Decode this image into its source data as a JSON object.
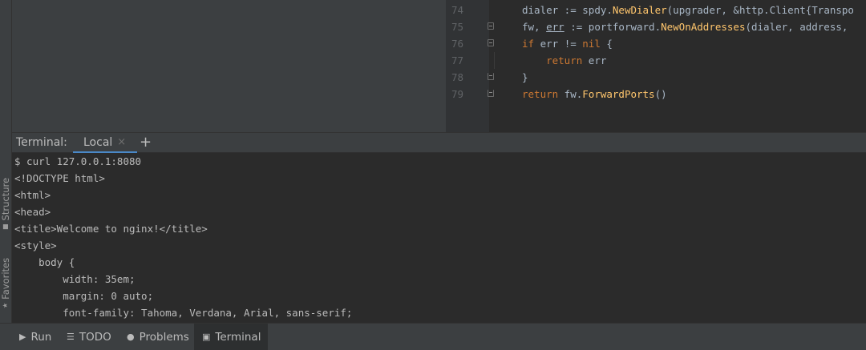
{
  "side_tabs": {
    "structure": "Structure",
    "favorites": "Favorites"
  },
  "editor": {
    "lines": [
      {
        "num": "74",
        "parts": [
          [
            "",
            "dialer := "
          ],
          [
            "pkg",
            "spdy."
          ],
          [
            "fn",
            "NewDialer"
          ],
          [
            "",
            "(upgrader, &"
          ],
          [
            "pkg",
            "http."
          ],
          [
            "ty",
            "Client"
          ],
          [
            "",
            "{Transpo"
          ]
        ]
      },
      {
        "num": "75",
        "parts": [
          [
            "",
            "fw, "
          ],
          [
            "err",
            "err"
          ],
          [
            "",
            " := "
          ],
          [
            "pkg",
            "portforward."
          ],
          [
            "fn",
            "NewOnAddresses"
          ],
          [
            "",
            "(dialer, address, "
          ]
        ]
      },
      {
        "num": "76",
        "parts": [
          [
            "kw",
            "if"
          ],
          [
            "",
            " err != "
          ],
          [
            "kw",
            "nil"
          ],
          [
            "",
            " {"
          ]
        ]
      },
      {
        "num": "77",
        "parts": [
          [
            "",
            "    "
          ],
          [
            "kw",
            "return"
          ],
          [
            "",
            " err"
          ]
        ]
      },
      {
        "num": "78",
        "parts": [
          [
            "",
            "}"
          ]
        ]
      },
      {
        "num": "79",
        "parts": [
          [
            "kw",
            "return"
          ],
          [
            "",
            " fw."
          ],
          [
            "fn",
            "ForwardPorts"
          ],
          [
            "",
            "()"
          ]
        ]
      }
    ]
  },
  "terminal": {
    "title": "Terminal:",
    "tab_label": "Local",
    "close_glyph": "×",
    "add_glyph": "+",
    "lines": [
      "$ curl 127.0.0.1:8080",
      "<!DOCTYPE html>",
      "<html>",
      "<head>",
      "<title>Welcome to nginx!</title>",
      "<style>",
      "    body {",
      "        width: 35em;",
      "        margin: 0 auto;",
      "        font-family: Tahoma, Verdana, Arial, sans-serif;"
    ]
  },
  "bottom_bar": {
    "run": "Run",
    "todo": "TODO",
    "problems": "Problems",
    "terminal": "Terminal"
  }
}
